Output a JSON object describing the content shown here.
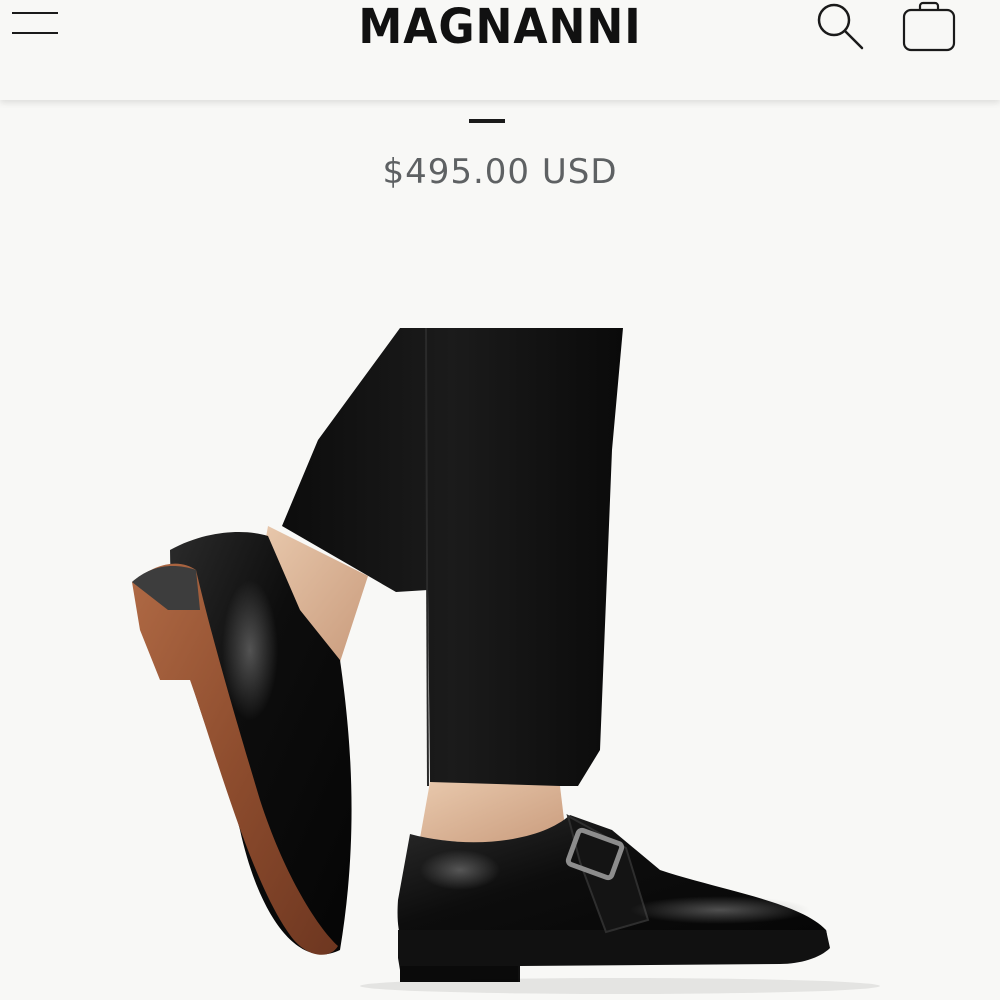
{
  "header": {
    "brand": "MAGNANNI",
    "menu_icon": "hamburger-menu-icon",
    "search_icon": "search-icon",
    "cart_icon": "shopping-bag-icon"
  },
  "product": {
    "price": "$495.00 USD",
    "image": "black-leather-single-monk-strap-shoes-on-model"
  },
  "colors": {
    "background": "#f8f8f6",
    "text_dark": "#111111",
    "price_gray": "#5e6163",
    "sole_brown": "#8a4a2c"
  }
}
